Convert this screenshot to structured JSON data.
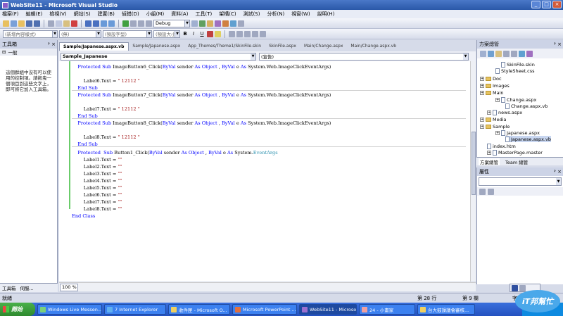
{
  "window": {
    "title": "WebSite11 - Microsoft Visual Studio"
  },
  "menu": [
    "檔案(F)",
    "編輯(E)",
    "檢視(V)",
    "網站(S)",
    "建置(B)",
    "偵錯(D)",
    "小組(M)",
    "資料(A)",
    "工具(T)",
    "架構(C)",
    "測試(S)",
    "分析(N)",
    "視窗(W)",
    "說明(H)"
  ],
  "toolbar": {
    "config": "Debug",
    "new_element": "(新增內容樣式)",
    "font_family": "(無)",
    "font_size": "(預設字型)",
    "block_format": "(預設大小"
  },
  "toolbox": {
    "title": "工具箱",
    "group": "一般",
    "message": "這個群組中沒有可以使用的控制項。請拖曳一個項目到這些文字上，即可將它加入工具箱。",
    "tab1": "工具箱",
    "tab2": "伺服..."
  },
  "doc_tabs": [
    "Sample/Japanese.aspx.vb",
    "Sample/Japanese.aspx",
    "App_Themes/Theme1/SkinFile.skin",
    "SkinFile.aspx",
    "Main/Change.aspx",
    "Main/Change.aspx.vb"
  ],
  "nav": {
    "class_combo": "Sample_Japanese",
    "member_combo": "(宣告)"
  },
  "code": {
    "l1": [
      "    Protected Sub ImageButton6_Click(ByVal sender As Object, ByVal e As System.Web.ImageClickEventArgs)"
    ],
    "lines": [
      {
        "indent": "    ",
        "parts": [
          [
            "kw",
            "Protected Sub "
          ],
          [
            "",
            "ImageButton6_Click("
          ],
          [
            "kw",
            "ByVal "
          ],
          [
            "",
            "sender "
          ],
          [
            "kw",
            "As Object"
          ],
          [
            "",
            " , "
          ],
          [
            "kw",
            "ByVal "
          ],
          [
            "",
            "e "
          ],
          [
            "kw",
            "As "
          ],
          [
            "",
            "System.Web.ImageClickEventArgs)"
          ]
        ]
      },
      {
        "indent": "",
        "parts": [
          [
            "",
            ""
          ]
        ]
      },
      {
        "indent": "        ",
        "parts": [
          [
            "",
            "Label6.Text = "
          ],
          [
            "st",
            "\" 12112 \""
          ]
        ]
      },
      {
        "indent": "    ",
        "parts": [
          [
            "kw",
            "End Sub"
          ]
        ]
      },
      {
        "indent": "    ",
        "parts": [
          [
            "kw",
            "Protected Sub "
          ],
          [
            "",
            "ImageButton7_Click("
          ],
          [
            "kw",
            "ByVal "
          ],
          [
            "",
            "sender "
          ],
          [
            "kw",
            "As Object"
          ],
          [
            "",
            " , "
          ],
          [
            "kw",
            "ByVal "
          ],
          [
            "",
            "e "
          ],
          [
            "kw",
            "As "
          ],
          [
            "",
            "System.Web.ImageClickEventArgs)"
          ]
        ]
      },
      {
        "indent": "",
        "parts": [
          [
            "",
            ""
          ]
        ]
      },
      {
        "indent": "        ",
        "parts": [
          [
            "",
            "Label7.Text = "
          ],
          [
            "st",
            "\" 12112 \""
          ]
        ]
      },
      {
        "indent": "    ",
        "parts": [
          [
            "kw",
            "End Sub"
          ]
        ]
      },
      {
        "indent": "    ",
        "parts": [
          [
            "kw",
            "Protected Sub "
          ],
          [
            "",
            "ImageButton8_Click("
          ],
          [
            "kw",
            "ByVal "
          ],
          [
            "",
            "sender "
          ],
          [
            "kw",
            "As Object"
          ],
          [
            "",
            " , "
          ],
          [
            "kw",
            "ByVal "
          ],
          [
            "",
            "e "
          ],
          [
            "kw",
            "As "
          ],
          [
            "",
            "System.Web.ImageClickEventArgs)"
          ]
        ]
      },
      {
        "indent": "",
        "parts": [
          [
            "",
            ""
          ]
        ]
      },
      {
        "indent": "        ",
        "parts": [
          [
            "",
            "Label8.Text = "
          ],
          [
            "st",
            "\" 12112 \""
          ]
        ]
      },
      {
        "indent": "    ",
        "parts": [
          [
            "kw",
            "End Sub"
          ]
        ]
      },
      {
        "indent": "    ",
        "parts": [
          [
            "kw",
            "Protected  Sub "
          ],
          [
            "",
            "Button1_Click("
          ],
          [
            "kw",
            "ByVal "
          ],
          [
            "",
            "sender "
          ],
          [
            "kw",
            "As Object "
          ],
          [
            "",
            ", "
          ],
          [
            "kw",
            "ByVal "
          ],
          [
            "",
            "e "
          ],
          [
            "kw",
            "As "
          ],
          [
            "",
            "System."
          ],
          [
            "ty",
            "EventArgs"
          ]
        ]
      },
      {
        "indent": "        ",
        "parts": [
          [
            "",
            "Label1.Text = "
          ],
          [
            "st",
            "\"\""
          ]
        ]
      },
      {
        "indent": "        ",
        "parts": [
          [
            "",
            "Label2.Text = "
          ],
          [
            "st",
            "\"\""
          ]
        ]
      },
      {
        "indent": "        ",
        "parts": [
          [
            "",
            "Label3.Text = "
          ],
          [
            "st",
            "\"\""
          ]
        ]
      },
      {
        "indent": "        ",
        "parts": [
          [
            "",
            "Label4.Text = "
          ],
          [
            "st",
            "\"\""
          ]
        ]
      },
      {
        "indent": "        ",
        "parts": [
          [
            "",
            "Label5.Text = "
          ],
          [
            "st",
            "\"\""
          ]
        ]
      },
      {
        "indent": "        ",
        "parts": [
          [
            "",
            "Label6.Text = "
          ],
          [
            "st",
            "\"\""
          ]
        ]
      },
      {
        "indent": "        ",
        "parts": [
          [
            "",
            "Label7.Text = "
          ],
          [
            "st",
            "\"\""
          ]
        ]
      },
      {
        "indent": "        ",
        "parts": [
          [
            "",
            "Label8.Text = "
          ],
          [
            "st",
            "\"\""
          ]
        ]
      },
      {
        "indent": "",
        "parts": [
          [
            "kw",
            "End Class"
          ]
        ]
      }
    ]
  },
  "zoom": "100 %",
  "solution_explorer": {
    "title": "方案總管",
    "nodes": [
      "SkinFile.skin",
      "StyleSheet.css",
      "Doc",
      "Images",
      "Main",
      "Change.aspx",
      "Change.aspx.vb",
      "news.aspx",
      "Media",
      "Sample",
      "Japanese.aspx",
      "Japanese.aspx.vb",
      "index.htm",
      "MasterPage.master"
    ],
    "tab1": "方案總管",
    "tab2": "Team 總管"
  },
  "properties": {
    "title": "屬性"
  },
  "status": {
    "ready": "就緒",
    "line": "第 28 行",
    "col": "第 9 欄",
    "char": "字元 9"
  },
  "taskbar": {
    "start": "開始",
    "tasks": [
      "Windows Live Messen...",
      "7 Internet Explorer",
      "收件匣 - Microsoft O...",
      "Microsoft PowerPoint ...",
      "WebSite11 - Microsoft...",
      "24 - 小畫家",
      "台大鼓譟議會審核..."
    ]
  },
  "brand": "iT邦幫忙"
}
